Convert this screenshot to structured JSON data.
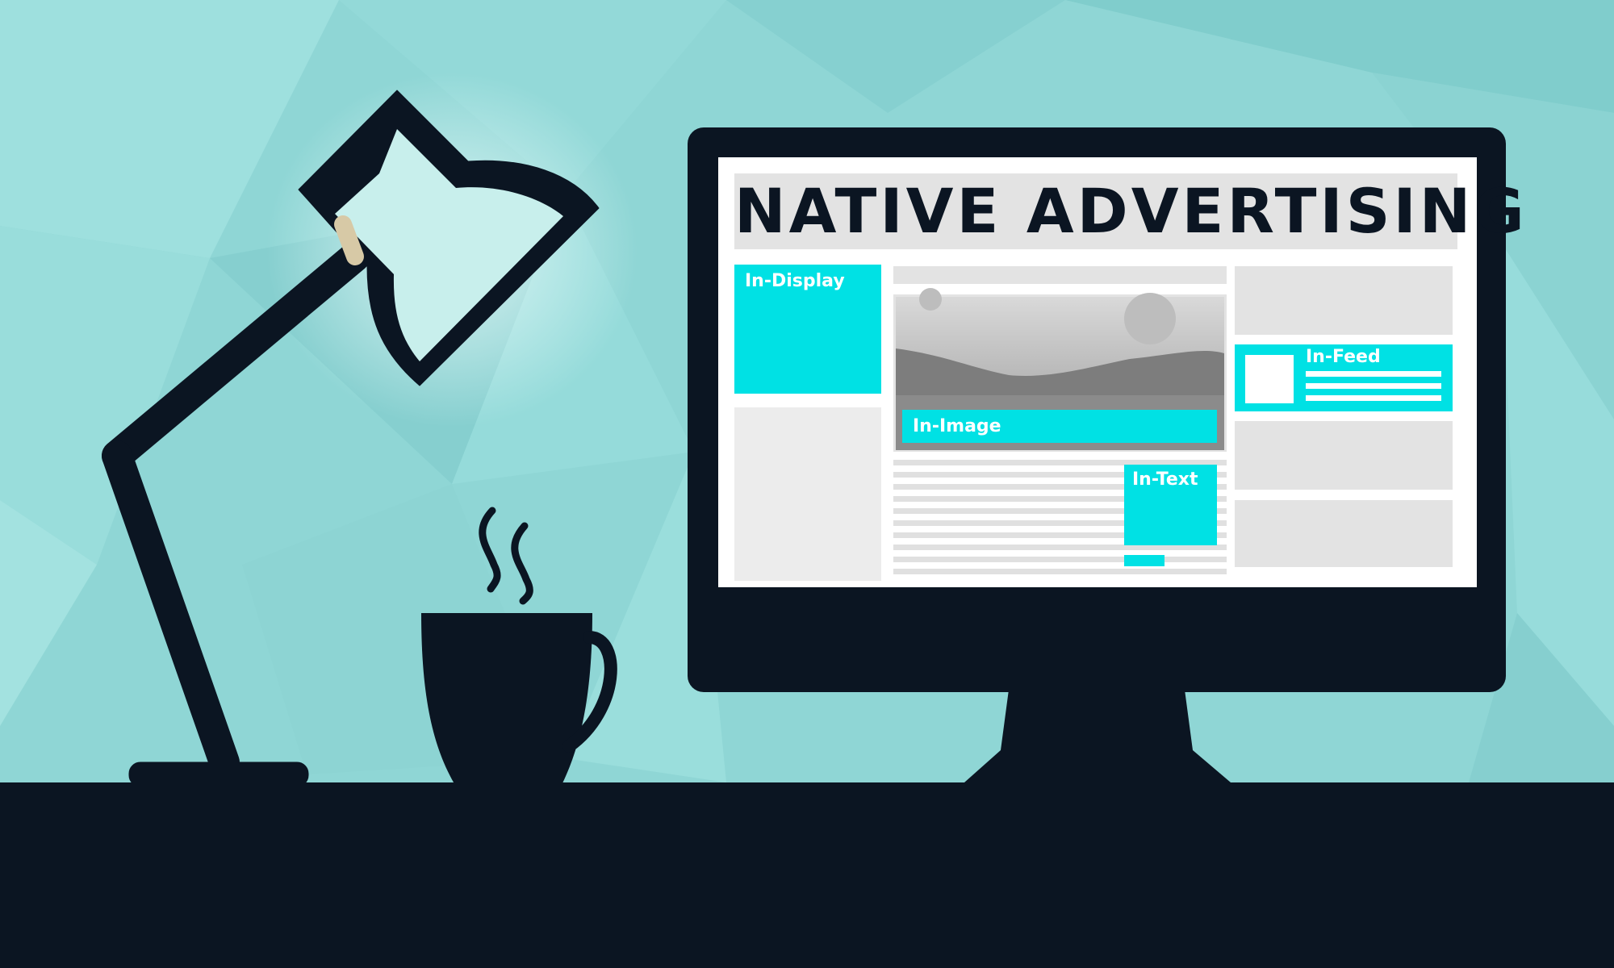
{
  "screen": {
    "headline": "NATIVE ADVERTISING",
    "labels": {
      "in_display": "In-Display",
      "in_image": "In-Image",
      "in_feed": "In-Feed",
      "in_text": "In-Text"
    }
  },
  "colors": {
    "background": "#8fd6d5",
    "dark": "#0b1522",
    "accent": "#00e1e4",
    "panel": "#e3e3e3",
    "screen": "#ffffff"
  },
  "icons": [
    "desk-lamp-icon",
    "coffee-cup-icon",
    "steam-icon",
    "monitor-icon",
    "landscape-image-icon"
  ]
}
